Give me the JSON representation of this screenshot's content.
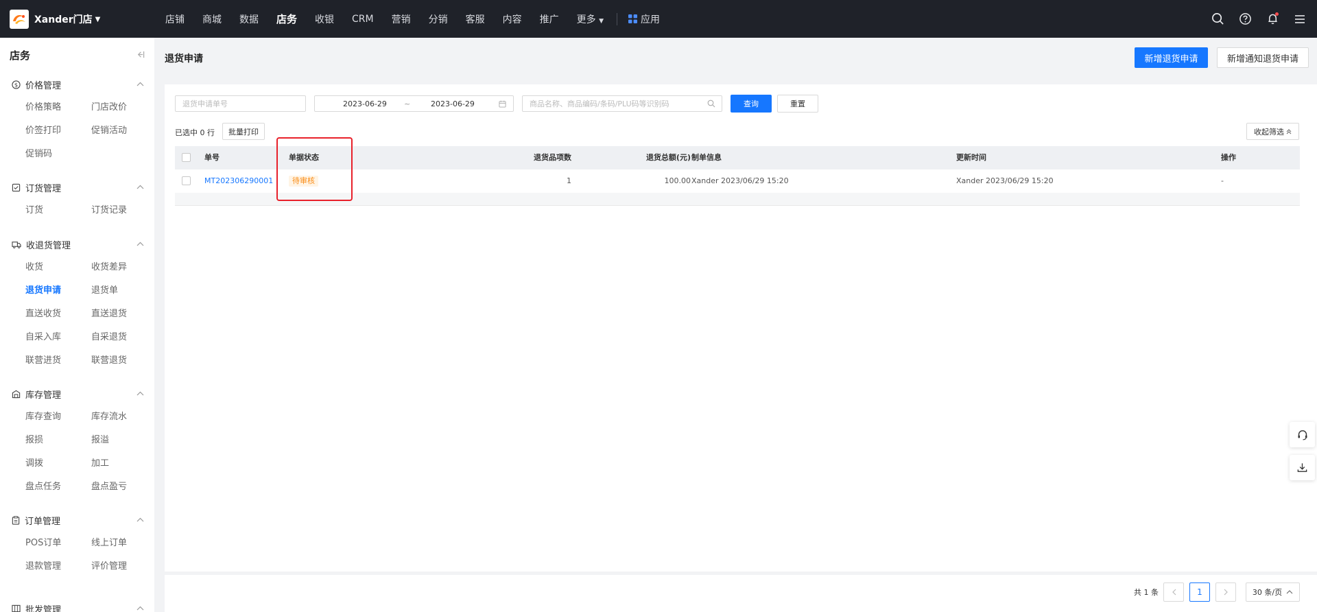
{
  "brand": {
    "name": "Xander门店"
  },
  "nav": {
    "items": [
      "店铺",
      "商城",
      "数据",
      "店务",
      "收银",
      "CRM",
      "营销",
      "分销",
      "客服",
      "内容",
      "推广",
      "更多"
    ],
    "active_index": 3,
    "apps_label": "应用"
  },
  "sidebar": {
    "title": "店务",
    "groups": [
      {
        "label": "价格管理",
        "icon": "dollar-circle-icon",
        "items": [
          "价格策略",
          "门店改价",
          "价签打印",
          "促销活动",
          "促销码"
        ]
      },
      {
        "label": "订货管理",
        "icon": "order-icon",
        "items": [
          "订货",
          "订货记录"
        ]
      },
      {
        "label": "收退货管理",
        "icon": "truck-icon",
        "items": [
          "收货",
          "收货差异",
          "退货申请",
          "退货单",
          "直送收货",
          "直送退货",
          "自采入库",
          "自采退货",
          "联营进货",
          "联营退货"
        ],
        "active": "退货申请"
      },
      {
        "label": "库存管理",
        "icon": "warehouse-icon",
        "items": [
          "库存查询",
          "库存流水",
          "报损",
          "报溢",
          "调拨",
          "加工",
          "盘点任务",
          "盘点盈亏"
        ]
      },
      {
        "label": "订单管理",
        "icon": "clipboard-icon",
        "items": [
          "POS订单",
          "线上订单",
          "退款管理",
          "评价管理"
        ]
      },
      {
        "label": "批发管理",
        "icon": "wholesale-icon",
        "items": []
      }
    ]
  },
  "page": {
    "title": "退货申请",
    "new_button": "新增退货申请",
    "notify_button": "新增通知退货申请"
  },
  "filters": {
    "order_no_placeholder": "退货申请单号",
    "date_start": "2023-06-29",
    "date_sep": "~",
    "date_end": "2023-06-29",
    "product_placeholder": "商品名称、商品编码/条码/PLU码等识别码",
    "query_button": "查询",
    "reset_button": "重置"
  },
  "selection": {
    "selected_text": "已选中 0 行",
    "batch_print": "批量打印",
    "collapse_filter": "收起筛选"
  },
  "table": {
    "headers": [
      "单号",
      "单据状态",
      "退货品项数",
      "退货总额(元)",
      "制单信息",
      "更新时间",
      "操作"
    ],
    "rows": [
      {
        "order_no": "MT202306290001",
        "status": "待审核",
        "item_count": "1",
        "total": "100.00",
        "created": "Xander 2023/06/29 15:20",
        "updated": "Xander 2023/06/29 15:20",
        "action": "-"
      }
    ]
  },
  "pagination": {
    "total_text": "共 1 条",
    "current_page": "1",
    "page_size": "30 条/页"
  },
  "colors": {
    "primary": "#1677ff",
    "topbar": "#1f2229",
    "status_pending": "#fa8c16",
    "highlight": "#e8202a"
  }
}
